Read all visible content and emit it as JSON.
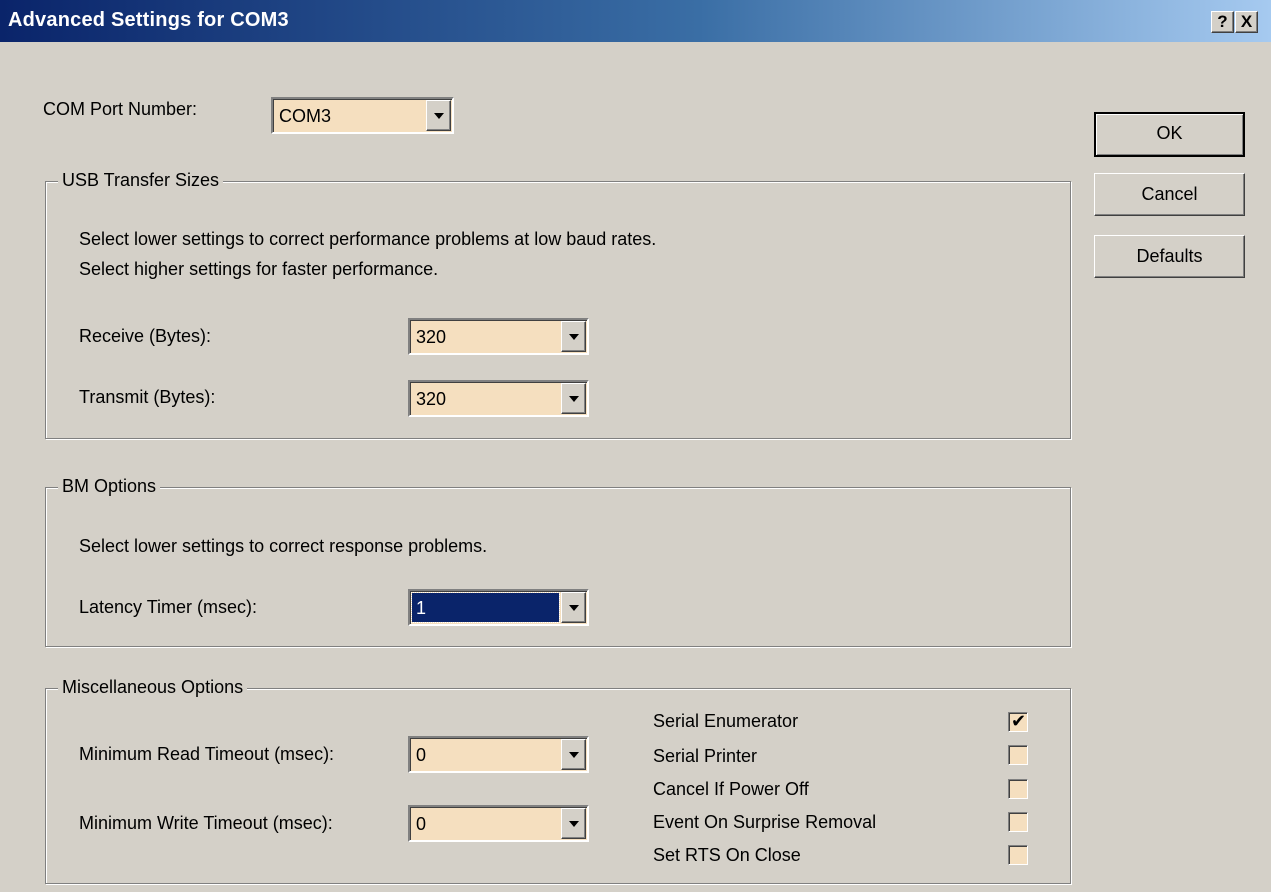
{
  "window": {
    "title": "Advanced Settings for COM3",
    "help_label": "?",
    "close_label": "X"
  },
  "com_port": {
    "label": "COM Port Number:",
    "value": "COM3"
  },
  "buttons": {
    "ok": "OK",
    "cancel": "Cancel",
    "defaults": "Defaults"
  },
  "usb_transfer": {
    "legend": "USB Transfer Sizes",
    "desc1": "Select lower settings to correct performance problems at low baud rates.",
    "desc2": "Select higher settings for faster performance.",
    "receive_label": "Receive (Bytes):",
    "receive_value": "320",
    "transmit_label": "Transmit (Bytes):",
    "transmit_value": "320"
  },
  "bm_options": {
    "legend": "BM Options",
    "desc": "Select lower settings to correct response problems.",
    "latency_label": "Latency Timer (msec):",
    "latency_value": "1"
  },
  "misc": {
    "legend": "Miscellaneous Options",
    "read_timeout_label": "Minimum Read Timeout (msec):",
    "read_timeout_value": "0",
    "write_timeout_label": "Minimum Write Timeout (msec):",
    "write_timeout_value": "0",
    "checkboxes": [
      {
        "label": "Serial Enumerator",
        "checked": true
      },
      {
        "label": "Serial Printer",
        "checked": false
      },
      {
        "label": "Cancel If Power Off",
        "checked": false
      },
      {
        "label": "Event On Surprise Removal",
        "checked": false
      },
      {
        "label": "Set RTS On Close",
        "checked": false
      }
    ],
    "check_glyph": "✔"
  },
  "colors": {
    "title_start": "#0a246a",
    "title_end": "#a6caf0",
    "face": "#d4d0c8",
    "field": "#f5dfbf",
    "selection": "#0a246a"
  }
}
